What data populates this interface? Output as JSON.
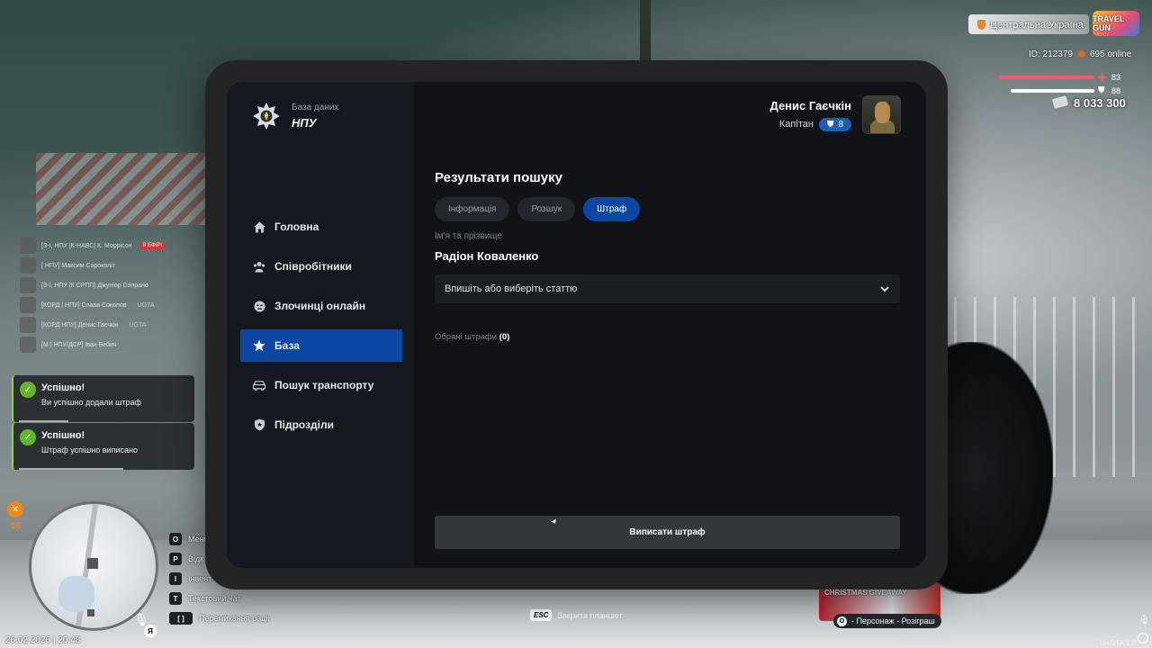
{
  "hud": {
    "region": "Центральна Україна",
    "logo_text": "TRAVEL GUN",
    "player_id": "ID: 212379",
    "online": "695 online",
    "health": "83",
    "armor": "88",
    "money": "8 033 300",
    "hunger": "16",
    "datetime": "26.02.2026 | 20:48",
    "map_lang": "Я",
    "version": "UAGTA 1.0"
  },
  "voice_list": [
    {
      "name": "[З-І, НПУ |К-НАВС| К. Моррісон",
      "live": "В ЕФІРІ"
    },
    {
      "name": "[ НПУ] Максим Сароколіт",
      "live": ""
    },
    {
      "name": "[З-І, НПУ |К СРПП] Джуніор Сопрано",
      "live": ""
    },
    {
      "name": "[КОРД | НПУ] Слава Соколов",
      "live": "UGTA"
    },
    {
      "name": "[КОРД НПУ] Денис Гаєчкін",
      "live": "UGTA"
    },
    {
      "name": "[М | НПУ/ДСР] Іван Бебич",
      "live": ""
    }
  ],
  "toasts": [
    {
      "title": "Успішно!",
      "message": "Ви успішно додали штраф"
    },
    {
      "title": "Успішно!",
      "message": "Штраф успішно виписано"
    }
  ],
  "keys": [
    {
      "key": "O",
      "label": "Меню"
    },
    {
      "key": "P",
      "label": "Відк"
    },
    {
      "key": "I",
      "label": "Інвент"
    },
    {
      "key": "T",
      "label": "Текстовий чат"
    },
    {
      "key": "[  ]",
      "label": "Перемикання раціі"
    }
  ],
  "esc_hint": {
    "key": "ESC",
    "label": "Закрити планшет"
  },
  "promo": {
    "title": "CHRISTMAS GIVEAWAY",
    "sub_key": "O",
    "sub_label": "- Персонаж - Розіграш"
  },
  "tablet": {
    "brand_sub": "База даних",
    "brand_title": "НПУ",
    "user_name": "Денис Гаєчкін",
    "user_rank": "Капітан",
    "user_level": "8",
    "nav": [
      {
        "label": "Головна",
        "icon": "home-icon"
      },
      {
        "label": "Співробітники",
        "icon": "users-icon"
      },
      {
        "label": "Злочинці онлайн",
        "icon": "criminal-icon"
      },
      {
        "label": "База",
        "icon": "star-icon"
      },
      {
        "label": "Пошук транспорту",
        "icon": "car-icon"
      },
      {
        "label": "Підрозділи",
        "icon": "shield-icon"
      }
    ],
    "active_nav": "База",
    "page_title": "Результати пошуку",
    "tabs": [
      "Інформація",
      "Розшук",
      "Штраф"
    ],
    "active_tab": "Штраф",
    "name_label": "Ім'я та прізвище",
    "person_name": "Радіон Коваленко",
    "select_placeholder": "Впишіть або виберіть статтю",
    "chosen_label": "Обрані штрафи",
    "chosen_count": "(0)",
    "submit_label": "Виписати штраф"
  },
  "colors": {
    "accent": "#0c47a3",
    "success": "#62b72d",
    "health": "#ee5b6a",
    "screen_bg": "#111318"
  }
}
